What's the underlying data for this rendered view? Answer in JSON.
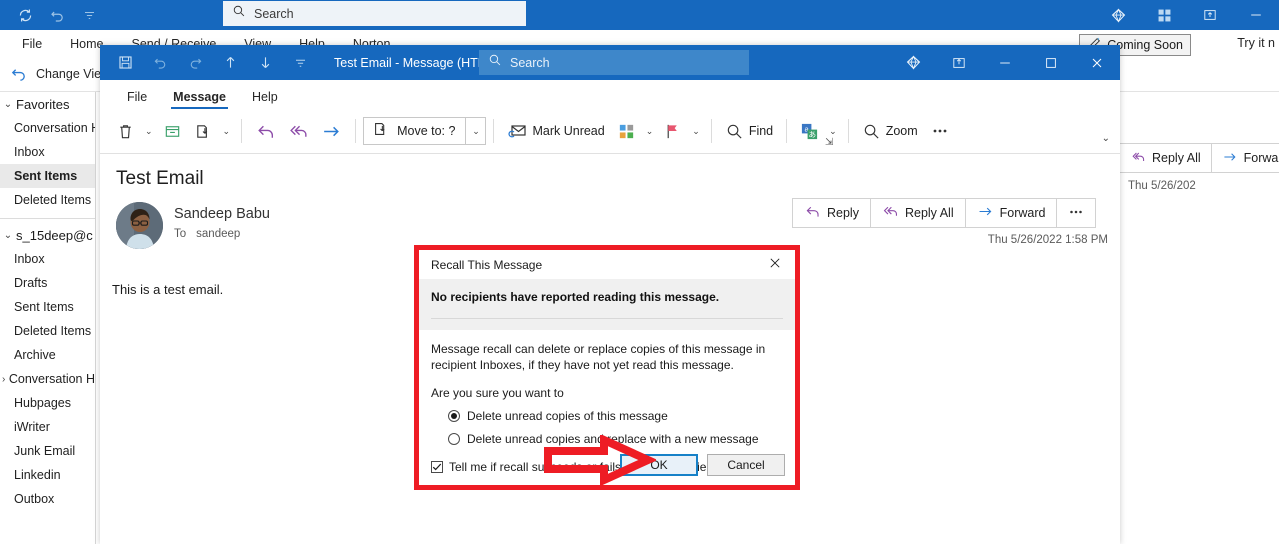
{
  "main_window": {
    "quick_access": [
      "refresh-icon",
      "undo-icon",
      "customize-qat-icon"
    ],
    "search": {
      "placeholder": "Search",
      "icon": "search-icon"
    },
    "title_buttons": [
      "diamond-icon",
      "apps-icon",
      "restore-window-icon",
      "minimize-icon"
    ],
    "menu": [
      "File",
      "Home",
      "Send / Receive",
      "View",
      "Help",
      "Norton"
    ],
    "ribbon": {
      "change_view_label": "Change Vie",
      "change_view_icon": "change-view-icon"
    },
    "coming_soon": {
      "label": "Coming Soon",
      "icon": "pen-sparkle-icon"
    },
    "try_it": "Try it n"
  },
  "sidebar": {
    "favorites": {
      "label": "Favorites",
      "chevron": "chevron-down-icon",
      "items": [
        {
          "label": "Conversation H",
          "selected": false
        },
        {
          "label": "Inbox",
          "selected": false
        },
        {
          "label": "Sent Items",
          "selected": true
        },
        {
          "label": "Deleted Items",
          "selected": false
        }
      ]
    },
    "account": {
      "label": "s_15deep@c",
      "chevron": "chevron-down-icon",
      "items": [
        {
          "label": "Inbox",
          "expandable": false
        },
        {
          "label": "Drafts",
          "expandable": false
        },
        {
          "label": "Sent Items",
          "expandable": false
        },
        {
          "label": "Deleted Items",
          "expandable": false
        },
        {
          "label": "Archive",
          "expandable": false
        },
        {
          "label": "Conversation H",
          "expandable": true
        },
        {
          "label": "Hubpages",
          "expandable": false
        },
        {
          "label": "iWriter",
          "expandable": false
        },
        {
          "label": "Junk Email",
          "expandable": false
        },
        {
          "label": "Linkedin",
          "expandable": false
        },
        {
          "label": "Outbox",
          "expandable": false
        }
      ]
    }
  },
  "reading_pane_behind": {
    "buttons": [
      {
        "label": "Reply All",
        "icon": "reply-all-icon"
      },
      {
        "label": "Forward",
        "icon": "forward-icon"
      }
    ],
    "date": "Thu 5/26/202"
  },
  "message_window": {
    "titlebar": {
      "quick_access": [
        "save-icon",
        "undo-icon",
        "redo-icon",
        "previous-item-icon",
        "next-item-icon",
        "customize-qat-icon"
      ],
      "title": "Test Email  -  Message (HTML)",
      "search": {
        "placeholder": "Search",
        "icon": "search-icon"
      },
      "buttons": [
        "diamond-icon",
        "restore-window-icon",
        "minimize-icon",
        "maximize-icon",
        "close-icon"
      ]
    },
    "tabs": [
      {
        "label": "File",
        "active": false
      },
      {
        "label": "Message",
        "active": true
      },
      {
        "label": "Help",
        "active": false
      }
    ],
    "ribbon": [
      {
        "name": "delete",
        "label": "",
        "icon": "trash-icon",
        "caret": true
      },
      {
        "name": "archive",
        "label": "",
        "icon": "archive-icon",
        "caret": false
      },
      {
        "name": "move",
        "label": "",
        "icon": "move-icon",
        "caret": true
      },
      {
        "name": "reply",
        "label": "",
        "icon": "reply-icon",
        "caret": false
      },
      {
        "name": "reply-all",
        "label": "",
        "icon": "reply-all-icon",
        "caret": false
      },
      {
        "name": "forward",
        "label": "",
        "icon": "forward-icon",
        "caret": false
      },
      {
        "name": "mark-unread",
        "label": "Mark Unread",
        "icon": "envelope-sync-icon",
        "caret": false
      },
      {
        "name": "categorize",
        "label": "",
        "icon": "categorize-icon",
        "caret": true
      },
      {
        "name": "follow-up",
        "label": "",
        "icon": "flag-icon",
        "caret": true
      },
      {
        "name": "find",
        "label": "Find",
        "icon": "search-icon",
        "caret": false
      },
      {
        "name": "translate",
        "label": "",
        "icon": "translate-icon",
        "caret": true
      },
      {
        "name": "zoom",
        "label": "Zoom",
        "icon": "zoom-icon",
        "caret": false
      },
      {
        "name": "more",
        "label": "",
        "icon": "ellipsis-icon",
        "caret": false
      }
    ],
    "move_to": {
      "label": "Move to: ?",
      "icon": "move-icon"
    },
    "message": {
      "subject": "Test Email",
      "sender": "Sandeep Babu",
      "to_label": "To",
      "to_value": "sandeep",
      "body": "This is a test email.",
      "date": "Thu 5/26/2022 1:58 PM",
      "actions": [
        {
          "label": "Reply",
          "icon": "reply-icon"
        },
        {
          "label": "Reply All",
          "icon": "reply-all-icon"
        },
        {
          "label": "Forward",
          "icon": "forward-icon"
        },
        {
          "label": "•••",
          "icon": "ellipsis-icon"
        }
      ]
    }
  },
  "dialog": {
    "title": "Recall This Message",
    "close_icon": "close-icon",
    "headline": "No recipients have reported reading this message.",
    "paragraph": "Message recall can delete or replace copies of this message in recipient Inboxes, if they have not yet read this message.",
    "question": "Are you sure you want to",
    "options": [
      {
        "label": "Delete unread copies of this message",
        "selected": true
      },
      {
        "label": "Delete unread copies and replace with a new message",
        "selected": false
      }
    ],
    "checkbox": {
      "label": "Tell me if recall succeeds or fails for each recipient",
      "checked": true
    },
    "buttons": [
      {
        "label": "OK",
        "focused": true
      },
      {
        "label": "Cancel",
        "focused": false
      }
    ],
    "annotation": {
      "type": "arrow-annotation",
      "color": "#ee1c24"
    },
    "highlight_color": "#ee1c24"
  },
  "colors": {
    "titlebar_blue": "#1668be",
    "accent_blue": "#1781c8",
    "annotation_red": "#ee1c24"
  }
}
